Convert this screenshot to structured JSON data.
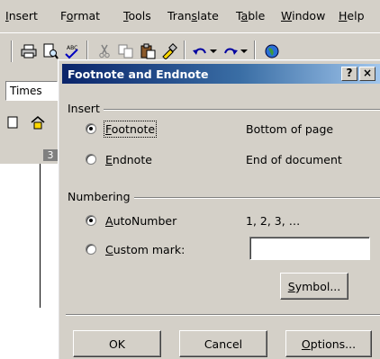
{
  "menubar": {
    "items": [
      {
        "label": "Insert",
        "underline_index": 0
      },
      {
        "label": "Format",
        "underline_index": 1
      },
      {
        "label": "Tools",
        "underline_index": 0
      },
      {
        "label": "Translate",
        "underline_index": 4
      },
      {
        "label": "Table",
        "underline_index": 1
      },
      {
        "label": "Window",
        "underline_index": 0
      },
      {
        "label": "Help",
        "underline_index": 0
      }
    ]
  },
  "toolbar": {
    "icons": [
      "print-icon",
      "print-preview-icon",
      "spelling-icon",
      "cut-icon",
      "copy-icon",
      "paste-icon",
      "format-painter-icon",
      "undo-icon",
      "redo-icon",
      "web-icon"
    ]
  },
  "format_bar": {
    "font_name": "Times"
  },
  "ruler": {
    "marker": "3"
  },
  "dialog": {
    "title": "Footnote and Endnote",
    "help_button": "?",
    "close_button": "×",
    "insert_group": {
      "label": "Insert",
      "options": [
        {
          "label": "Footnote",
          "mnemonic": "F",
          "selected": true,
          "description": "Bottom of page"
        },
        {
          "label": "Endnote",
          "mnemonic": "E",
          "selected": false,
          "description": "End of document"
        }
      ]
    },
    "numbering_group": {
      "label": "Numbering",
      "options": [
        {
          "label": "AutoNumber",
          "mnemonic": "A",
          "selected": true,
          "description": "1, 2, 3, …"
        },
        {
          "label": "Custom mark:",
          "mnemonic": "C",
          "selected": false
        }
      ],
      "custom_mark_value": "",
      "symbol_button": "Symbol..."
    },
    "buttons": {
      "ok": "OK",
      "cancel": "Cancel",
      "options": "Options..."
    }
  },
  "colors": {
    "face": "#d4d0c8",
    "title_start": "#0a246a",
    "title_end": "#a6caf0"
  }
}
